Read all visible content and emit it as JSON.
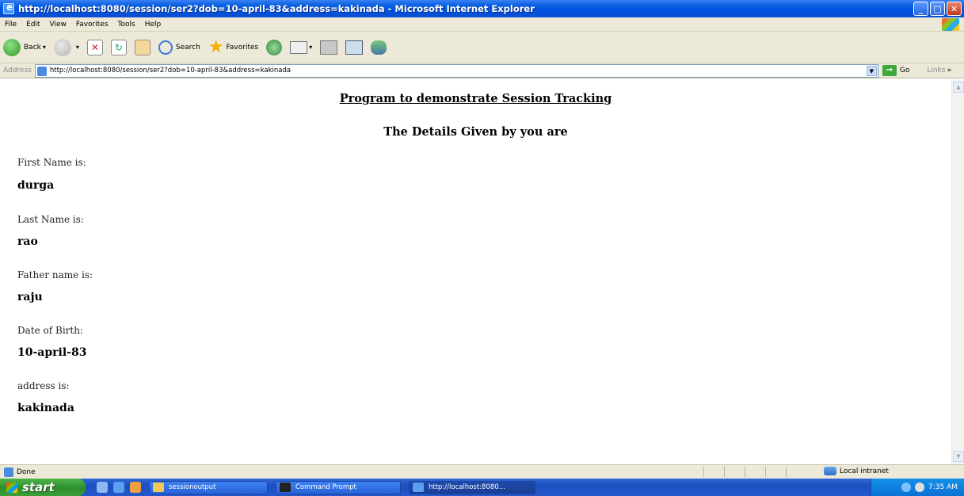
{
  "window": {
    "title": "http://localhost:8080/session/ser2?dob=10-april-83&address=kakinada - Microsoft Internet Explorer",
    "min_label": "_",
    "max_label": "□",
    "close_label": "✕"
  },
  "menu": [
    "File",
    "Edit",
    "View",
    "Favorites",
    "Tools",
    "Help"
  ],
  "toolbar": {
    "back_label": "Back",
    "search_label": "Search",
    "favorites_label": "Favorites"
  },
  "addressbar": {
    "label": "Address",
    "url": "http://localhost:8080/session/ser2?dob=10-april-83&address=kakinada",
    "go_label": "Go",
    "links_label": "Links",
    "links_chevron": "»"
  },
  "page": {
    "heading": "Program to demonstrate Session Tracking",
    "subheading": "The Details Given by you are",
    "fields": [
      {
        "label": "First Name is:",
        "value": "durga"
      },
      {
        "label": "Last Name is:",
        "value": "rao"
      },
      {
        "label": "Father name is:",
        "value": "raju"
      },
      {
        "label": "Date of Birth:",
        "value": "10-april-83"
      },
      {
        "label": "address is:",
        "value": "kakinada"
      }
    ]
  },
  "statusbar": {
    "status": "Done",
    "zone": "Local intranet"
  },
  "taskbar": {
    "start_label": "start",
    "tasks": [
      {
        "label": "sessionoutput"
      },
      {
        "label": "Command Prompt"
      },
      {
        "label": "http://localhost:8080..."
      }
    ],
    "clock": "7:35 AM"
  },
  "colors": {
    "titlebar": "#0053e1",
    "chrome": "#ece9d8",
    "taskbar": "#2458cb",
    "start": "#3aa036"
  }
}
